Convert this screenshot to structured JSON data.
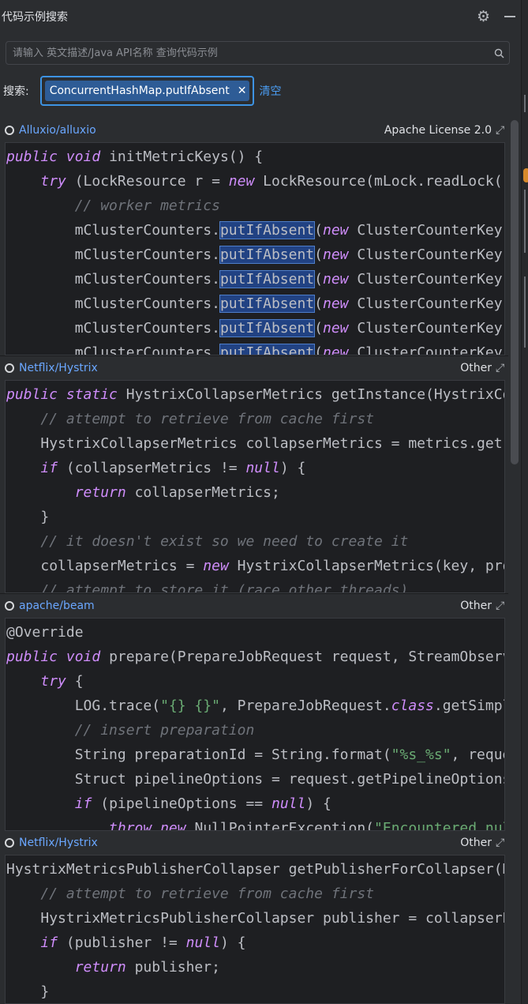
{
  "panel": {
    "title": "代码示例搜索",
    "icons": [
      "gear-icon",
      "minimize-icon"
    ]
  },
  "search": {
    "placeholder": "请输入 英文描述/Java API名称 查询代码示例",
    "value": ""
  },
  "query": {
    "label": "搜索:",
    "tag": "ConcurrentHashMap.putIfAbsent",
    "remove_symbol": "✕",
    "clear": "清空"
  },
  "results": [
    {
      "repo": "Alluxio/alluxio",
      "license": "Apache License 2.0"
    },
    {
      "repo": "Netflix/Hystrix",
      "license": "Other"
    },
    {
      "repo": "apache/beam",
      "license": "Other"
    },
    {
      "repo": "Netflix/Hystrix",
      "license": "Other"
    }
  ],
  "code": {
    "r0": {
      "l1a": "public",
      "l1b": "void",
      "l1c": "initMetricKeys() {",
      "l2a": "try",
      "l2b": "(LockResource r = ",
      "l2c": "new",
      "l2d": "LockResource(mLock.readLock()",
      "l3": "// worker metrics",
      "call": "mClusterCounters.",
      "api": "putIfAbsent",
      "paren": "(",
      "newkw": "new",
      "rest": " ClusterCounterKey("
    },
    "r1": {
      "l1a": "public",
      "l1b": "static",
      "l1c": "HystrixCollapserMetrics getInstance(HystrixCo",
      "l2": "// attempt to retrieve from cache first",
      "l3": "HystrixCollapserMetrics collapserMetrics = metrics.get(",
      "l4a": "if",
      "l4b": "(collapserMetrics != ",
      "l4c": "null",
      "l4d": ") {",
      "l5a": "return",
      "l5b": "collapserMetrics;",
      "l6": "}",
      "l7": "// it doesn't exist so we need to create it",
      "l8a": "collapserMetrics = ",
      "l8b": "new",
      "l8c": "HystrixCollapserMetrics(key, pro",
      "l9": "// attempt to store it (race other threads)"
    },
    "r2": {
      "l1": "@Override",
      "l2a": "public",
      "l2b": "void",
      "l2c": "prepare(PrepareJobRequest request, StreamObserv",
      "l3a": "try",
      "l3b": "{",
      "l4a": "LOG.trace(",
      "l4b": "\"{} {}\"",
      "l4c": ", PrepareJobRequest.",
      "l4d": "class",
      "l4e": ".getSimpl",
      "l5": "// insert preparation",
      "l6a": "String preparationId = String.format(",
      "l6b": "\"%s_%s\"",
      "l6c": ", reque",
      "l7": "Struct pipelineOptions = request.getPipelineOptions",
      "l8a": "if",
      "l8b": "(pipelineOptions == ",
      "l8c": "null",
      "l8d": ") {",
      "l9a": "throw",
      "l9b": "new",
      "l9c": "NullPointerException(",
      "l9d": "\"Encountered nul"
    },
    "r3": {
      "l1": "HystrixMetricsPublisherCollapser getPublisherForCollapser(H",
      "l2": "// attempt to retrieve from cache first",
      "l3": "HystrixMetricsPublisherCollapser publisher = collapserP",
      "l4a": "if",
      "l4b": "(publisher != ",
      "l4c": "null",
      "l4d": ") {",
      "l5a": "return",
      "l5b": "publisher;",
      "l6": "}"
    }
  },
  "colors": {
    "keyword": "#cf8dfb",
    "comment": "#6f737a",
    "string": "#6aab73",
    "repo_link": "#6aa7ff",
    "accent": "#3d93e3"
  }
}
